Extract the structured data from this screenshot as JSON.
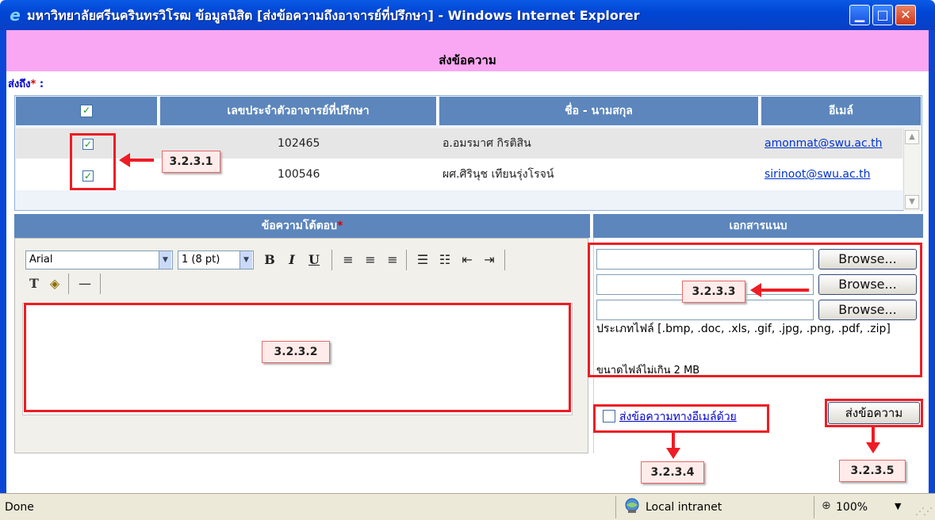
{
  "window": {
    "title": "มหาวิทยาลัยศรีนครินทรวิโรฒ ข้อมูลนิสิต [ส่งข้อความถึงอาจารย์ที่ปรึกษา] - Windows Internet Explorer",
    "minimize": "▁",
    "maximize": "□",
    "close": "✕"
  },
  "page": {
    "header": "ส่งข้อความ",
    "to_label": "ส่งถึง",
    "required_mark": "*",
    "to_colon": " :"
  },
  "recipients": {
    "columns": [
      "✓",
      "เลขประจำตัวอาจารย์ที่ปรึกษา",
      "ชื่อ - นามสกุล",
      "อีเมล์"
    ],
    "rows": [
      {
        "checked": "✓",
        "id": "102465",
        "name": "อ.อมรมาศ กิรติสิน",
        "email": "amonmat@swu.ac.th"
      },
      {
        "checked": "✓",
        "id": "100546",
        "name": "ผศ.ศิรินุช เทียนรุ่งโรจน์",
        "email": "sirinoot@swu.ac.th"
      }
    ],
    "scroll_up": "▲",
    "scroll_down": "▼"
  },
  "message": {
    "header": "ข้อความโต้ตอบ",
    "required_mark": "*",
    "font": "Arial",
    "size": "1 (8 pt)",
    "bold": "B",
    "italic": "I",
    "underline": "U",
    "align_left": "≡",
    "align_center": "≡",
    "align_right": "≡",
    "ordered_list": "☰",
    "unordered_list": "☷",
    "outdent": "⇤",
    "indent": "⇥",
    "text_color": "T",
    "bg_color": "◈",
    "hr": "—"
  },
  "attachment": {
    "header": "เอกสารแนบ",
    "browse": [
      "Browse...",
      "Browse...",
      "Browse..."
    ],
    "file_types": "ประเภทไฟล์ [.bmp, .doc, .xls, .gif, .jpg, .png, .pdf, .zip]",
    "file_size": "ขนาดไฟล์ไม่เกิน 2 MB"
  },
  "send_email_label": "ส่งข้อความทางอีเมล์ด้วย",
  "send_button": "ส่งข้อความ",
  "annotations": {
    "a1": "3.2.3.1",
    "a2": "3.2.3.2",
    "a3": "3.2.3.3",
    "a4": "3.2.3.4",
    "a5": "3.2.3.5"
  },
  "statusbar": {
    "status": "Done",
    "zone": "Local intranet",
    "zoom": "100%",
    "zoom_icon": "⊕",
    "dropdown": "▼"
  }
}
